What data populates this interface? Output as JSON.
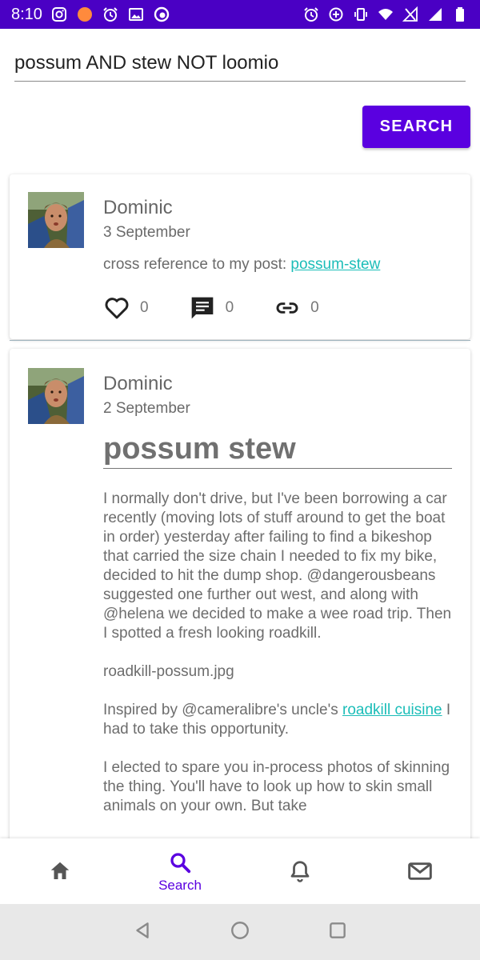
{
  "status_bar": {
    "time": "8:10"
  },
  "search": {
    "query": "possum AND stew NOT loomio",
    "button_label": "SEARCH"
  },
  "posts": [
    {
      "author": "Dominic",
      "date": "3 September",
      "text_prefix": "cross reference to my post: ",
      "link_text": "possum-stew",
      "likes": "0",
      "comments": "0",
      "links": "0"
    },
    {
      "author": "Dominic",
      "date": "2 September",
      "title": "possum stew",
      "paragraphs": [
        "I normally don't drive, but I've been borrowing a car recently (moving lots of stuff around to get the boat in order) yesterday after failing to find a bikeshop that carried the size chain I needed to fix my bike, decided to hit the dump shop. @dangerousbeans suggested one further out west, and along with @helena we decided to make a wee road trip. Then I spotted a fresh looking roadkill.",
        "roadkill-possum.jpg"
      ],
      "p3_prefix": "Inspired by @cameralibre's uncle's ",
      "p3_link": "roadkill cuisine",
      "p3_suffix": " I had to take this opportunity.",
      "p4": "I elected to spare you in-process photos of skinning the thing. You'll have to look up how to skin small animals on your own. But take"
    }
  ],
  "bottom_nav": {
    "home": "",
    "search": "Search",
    "notifications": "",
    "messages": ""
  },
  "colors": {
    "accent": "#5a00e0",
    "status_bar": "#4a00c4",
    "link": "#1bbdb8"
  },
  "icons": [
    "home-icon",
    "search-icon",
    "bell-icon",
    "mail-icon",
    "heart-icon",
    "comment-icon",
    "link-icon"
  ]
}
